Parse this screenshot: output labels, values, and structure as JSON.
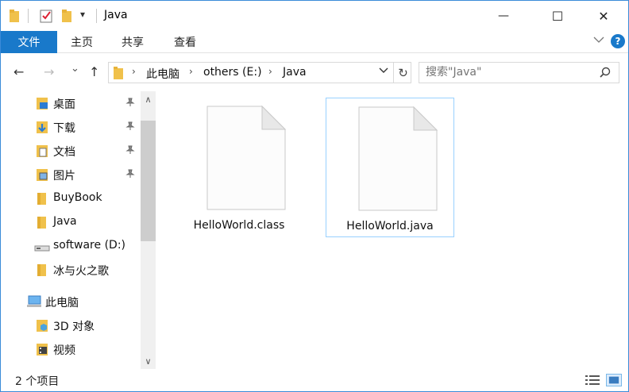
{
  "window": {
    "title": "Java"
  },
  "quick_access": {
    "dropdown_label": "▾"
  },
  "window_controls": {
    "minimize": "—",
    "maximize": "☐",
    "close": "✕"
  },
  "ribbon": {
    "file_tab": "文件",
    "tabs": [
      {
        "label": "主页"
      },
      {
        "label": "共享"
      },
      {
        "label": "查看"
      }
    ],
    "help": "?"
  },
  "nav": {
    "back": "←",
    "forward": "→",
    "recent": "⌄",
    "up": "↑"
  },
  "address": {
    "segments": [
      {
        "label": "此电脑"
      },
      {
        "label": "others (E:)"
      },
      {
        "label": "Java"
      }
    ],
    "refresh": "↻"
  },
  "search": {
    "placeholder": "搜索\"Java\""
  },
  "sidebar": {
    "items": [
      {
        "label": "桌面",
        "icon": "desktop-icon",
        "pinned": true
      },
      {
        "label": "下载",
        "icon": "downloads-icon",
        "pinned": true
      },
      {
        "label": "文档",
        "icon": "documents-icon",
        "pinned": true
      },
      {
        "label": "图片",
        "icon": "pictures-icon",
        "pinned": true
      },
      {
        "label": "BuyBook",
        "icon": "folder-icon",
        "pinned": false
      },
      {
        "label": "Java",
        "icon": "folder-icon",
        "pinned": false
      },
      {
        "label": "software (D:)",
        "icon": "drive-icon",
        "pinned": false
      },
      {
        "label": "冰与火之歌",
        "icon": "folder-icon",
        "pinned": false
      },
      {
        "label": "此电脑",
        "icon": "this-pc-icon",
        "pinned": false
      },
      {
        "label": "3D 对象",
        "icon": "3d-objects-icon",
        "pinned": false
      },
      {
        "label": "视频",
        "icon": "videos-icon",
        "pinned": false
      }
    ],
    "pin_glyph": "📌",
    "scroll_up": "∧",
    "scroll_down": "∨"
  },
  "files": [
    {
      "name": "HelloWorld.class",
      "selected": false
    },
    {
      "name": "HelloWorld.java",
      "selected": true
    }
  ],
  "status": {
    "count_text": "2 个项目"
  },
  "colors": {
    "accent": "#1979ca",
    "selection_border": "#99d1ff",
    "window_border": "#3b8bd9"
  }
}
